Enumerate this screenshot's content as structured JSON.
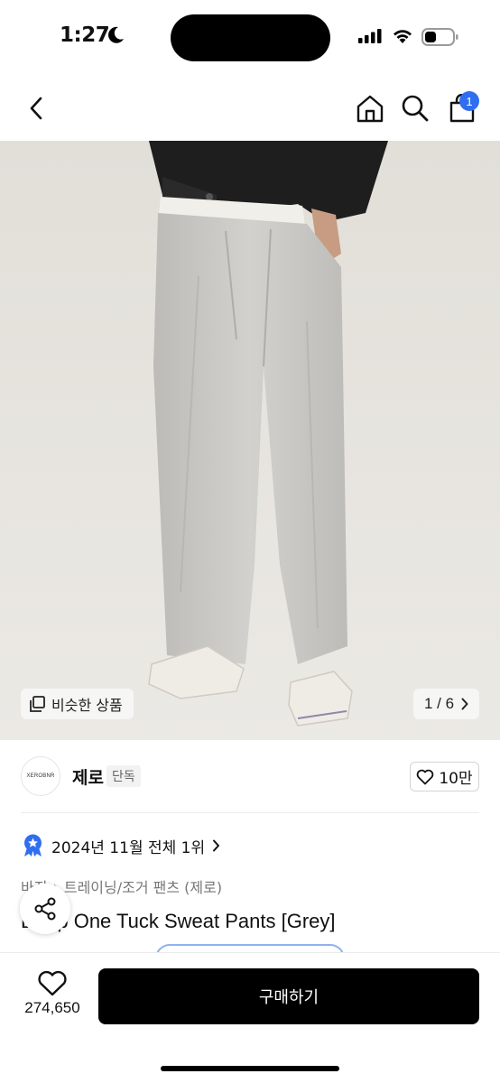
{
  "status_bar": {
    "time": "1:27"
  },
  "nav": {
    "cart_count": "1"
  },
  "gallery": {
    "similar_label": "비슷한 상품",
    "pager": "1 / 6"
  },
  "brand": {
    "logo_text": "XEROBNR",
    "name": "제로",
    "exclusive_label": "단독",
    "likes": "10만"
  },
  "ranking": {
    "label": "2024년 11월 전체 1위"
  },
  "category": {
    "parent": "바지",
    "separator": "›",
    "child": "트레이닝/조거 팬츠 (제로)"
  },
  "product": {
    "title": "Deep One Tuck Sweat Pants [Grey]"
  },
  "bottom_bar": {
    "wish_count": "274,650",
    "buy_label": "구매하기"
  },
  "colors": {
    "accent": "#2f6ef0",
    "buy_button": "#000000",
    "image_bg": "#e5e2dc",
    "pants": "#c9c8c4"
  }
}
